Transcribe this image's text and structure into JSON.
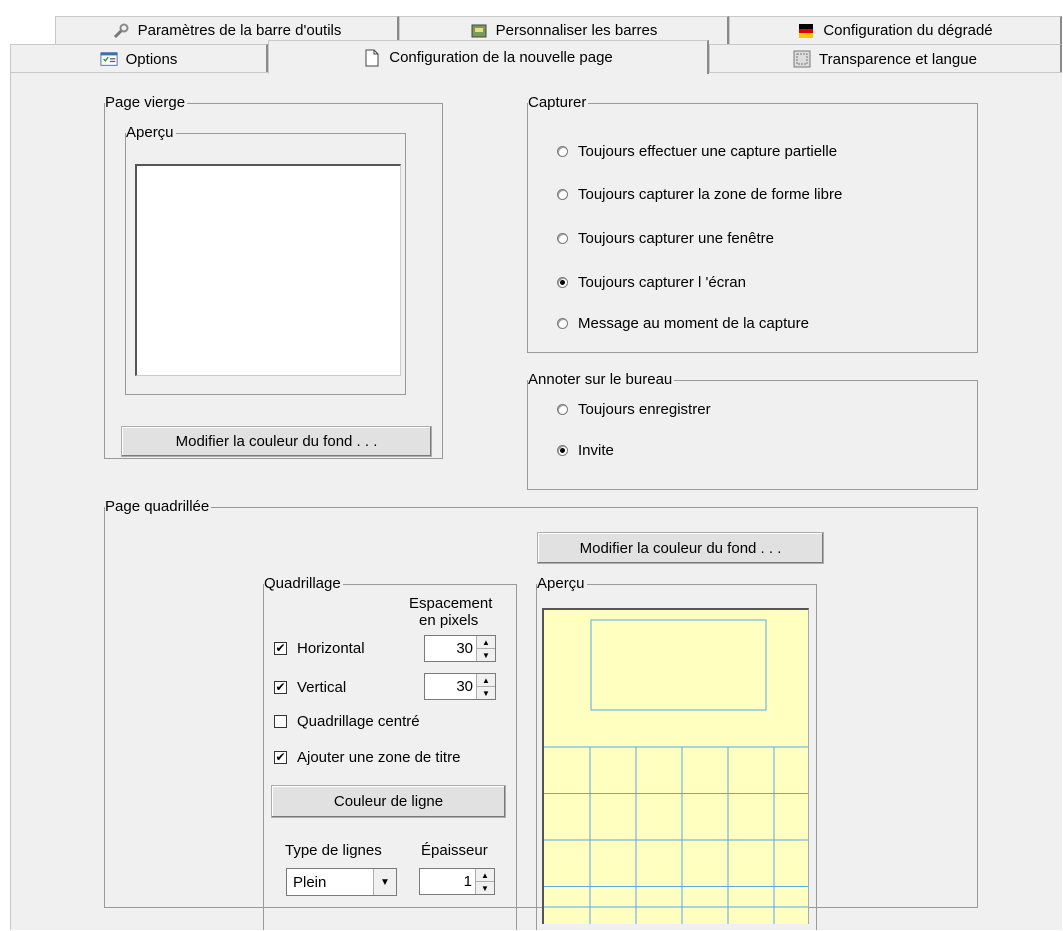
{
  "tabs": {
    "row1": [
      {
        "label": "Paramètres de la barre d'outils",
        "icon": "wrench-icon"
      },
      {
        "label": "Personnaliser les barres",
        "icon": "customize-icon"
      },
      {
        "label": "Configuration du dégradé",
        "icon": "gradient-flag-icon"
      }
    ],
    "row2": [
      {
        "label": "Options",
        "icon": "options-icon"
      },
      {
        "label": "Configuration de la nouvelle page",
        "icon": "page-icon"
      },
      {
        "label": "Transparence et langue",
        "icon": "transparency-icon"
      }
    ]
  },
  "blank_page": {
    "title": "Page vierge",
    "preview_title": "Aperçu",
    "change_bg_label": "Modifier la couleur du fond . . ."
  },
  "capture": {
    "title": "Capturer",
    "options": [
      {
        "label": "Toujours effectuer une capture partielle",
        "selected": false
      },
      {
        "label": "Toujours capturer la zone de forme libre",
        "selected": false
      },
      {
        "label": "Toujours capturer une fenêtre",
        "selected": false
      },
      {
        "label": "Toujours capturer l 'écran",
        "selected": true
      },
      {
        "label": "Message au moment de la capture",
        "selected": false
      }
    ]
  },
  "annotate": {
    "title": "Annoter sur le bureau",
    "options": [
      {
        "label": "Toujours enregistrer",
        "selected": false
      },
      {
        "label": "Invite",
        "selected": true
      }
    ]
  },
  "grid_page": {
    "title": "Page quadrillée",
    "change_bg_label": "Modifier la couleur du fond . . .",
    "grid": {
      "title": "Quadrillage",
      "spacing_label_1": "Espacement",
      "spacing_label_2": "en pixels",
      "horizontal": {
        "label": "Horizontal",
        "checked": true,
        "value": "30"
      },
      "vertical": {
        "label": "Vertical",
        "checked": true,
        "value": "30"
      },
      "centered": {
        "label": "Quadrillage centré",
        "checked": false
      },
      "title_zone": {
        "label": "Ajouter une zone de titre",
        "checked": true
      },
      "line_color_label": "Couleur de ligne",
      "line_type_label": "Type de lignes",
      "line_type_value": "Plein",
      "thickness_label": "Épaisseur",
      "thickness_value": "1"
    },
    "preview_title": "Aperçu",
    "preview_colors": {
      "background": "#ffffc0",
      "lines": "#5aa8e8"
    }
  }
}
